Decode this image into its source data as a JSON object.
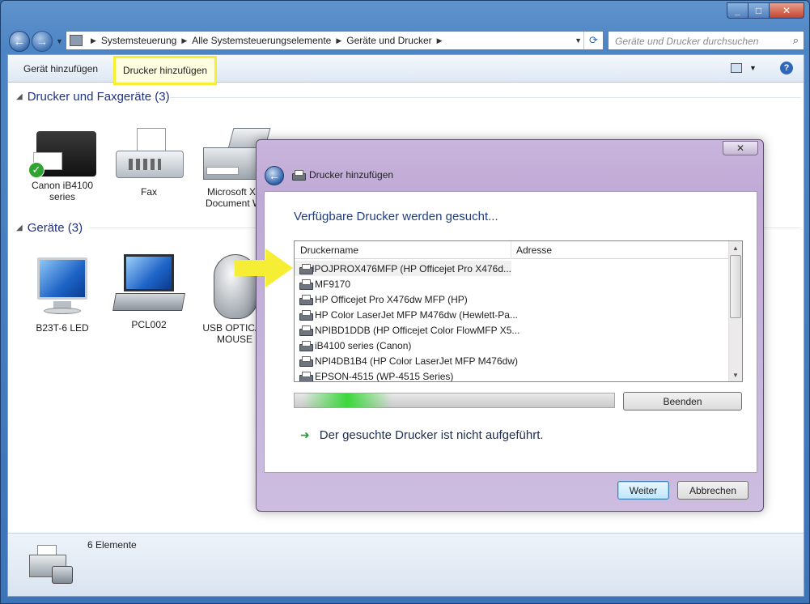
{
  "window": {
    "caption_buttons": {
      "minimize": "_",
      "maximize": "□",
      "close": "✕"
    }
  },
  "address_bar": {
    "segments": [
      "Systemsteuerung",
      "Alle Systemsteuerungselemente",
      "Geräte und Drucker"
    ],
    "search_placeholder": "Geräte und Drucker durchsuchen"
  },
  "toolbar": {
    "add_device": "Gerät hinzufügen",
    "add_printer": "Drucker hinzufügen",
    "highlight_color": "#f5ee34"
  },
  "groups": {
    "printers": {
      "title": "Drucker und Faxgeräte (3)",
      "items": [
        {
          "label": "Canon iB4100 series",
          "icon": "inkjet-printer-icon",
          "default": true
        },
        {
          "label": "Fax",
          "icon": "fax-icon"
        },
        {
          "label": "Microsoft XP Document Wi",
          "icon": "mfp-printer-icon"
        }
      ]
    },
    "devices": {
      "title": "Geräte (3)",
      "items": [
        {
          "label": "B23T-6 LED",
          "icon": "monitor-icon"
        },
        {
          "label": "PCL002",
          "icon": "laptop-icon"
        },
        {
          "label": "USB OPTICAL MOUSE",
          "icon": "mouse-icon"
        }
      ]
    }
  },
  "status_bar": {
    "count_text": "6 Elemente"
  },
  "dialog": {
    "title": "Drucker hinzufügen",
    "heading": "Verfügbare Drucker werden gesucht...",
    "columns": {
      "name": "Druckername",
      "address": "Adresse"
    },
    "printers": [
      "HPOJPROX476MFP (HP Officejet Pro X476d...",
      "MF9170",
      "HP Officejet Pro X476dw MFP (HP)",
      "HP Color LaserJet MFP M476dw (Hewlett-Pa...",
      "NPIBD1DDB (HP Officejet Color FlowMFP X5...",
      "iB4100 series (Canon)",
      "NPI4DB1B4 (HP Color LaserJet MFP M476dw)",
      "EPSON-4515 (WP-4515 Series)"
    ],
    "stop_button": "Beenden",
    "not_listed_link": "Der gesuchte Drucker ist nicht aufgeführt.",
    "next_button": "Weiter",
    "cancel_button": "Abbrechen",
    "close_glyph": "✕",
    "annotation_color": "#f5ee34"
  }
}
